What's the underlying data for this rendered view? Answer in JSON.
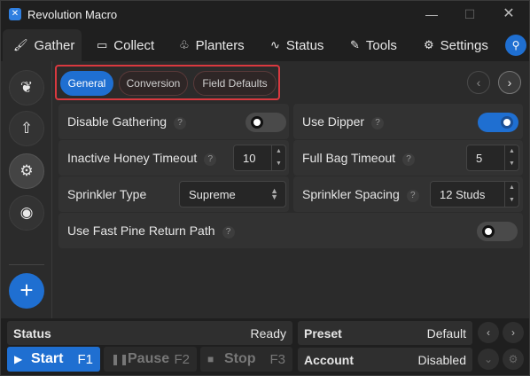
{
  "window": {
    "title": "Revolution Macro",
    "app_icon": "macro-app-icon",
    "controls": {
      "minimize": "—",
      "maximize": "☐",
      "close": "✕"
    }
  },
  "main_tabs": [
    {
      "label": "Gather",
      "icon": "brush-icon",
      "glyph": "🖌"
    },
    {
      "label": "Collect",
      "icon": "box-icon",
      "glyph": "▭"
    },
    {
      "label": "Planters",
      "icon": "sprout-icon",
      "glyph": "♧"
    },
    {
      "label": "Status",
      "icon": "pulse-icon",
      "glyph": "∿"
    },
    {
      "label": "Tools",
      "icon": "wrench-icon",
      "glyph": "✎"
    },
    {
      "label": "Settings",
      "icon": "gear-icon",
      "glyph": "⚙"
    }
  ],
  "search_icon": "⚲",
  "sidebar": {
    "buttons": [
      {
        "icon": "leaf-icon",
        "glyph": "❦"
      },
      {
        "icon": "arrow-up-icon",
        "glyph": "⇧"
      },
      {
        "icon": "gear-icon",
        "glyph": "⚙"
      },
      {
        "icon": "eye-scan-icon",
        "glyph": "◉"
      }
    ],
    "add_glyph": "+"
  },
  "subtabs": [
    "General",
    "Conversion",
    "Field Defaults"
  ],
  "nav": {
    "prev": "‹",
    "next": "›"
  },
  "settings": {
    "disable_gathering": {
      "label": "Disable Gathering",
      "value": false
    },
    "use_dipper": {
      "label": "Use Dipper",
      "value": true
    },
    "inactive_honey_timeout": {
      "label": "Inactive Honey Timeout",
      "value": "10"
    },
    "full_bag_timeout": {
      "label": "Full Bag Timeout",
      "value": "5"
    },
    "sprinkler_type": {
      "label": "Sprinkler Type",
      "value": "Supreme"
    },
    "sprinkler_spacing": {
      "label": "Sprinkler Spacing",
      "value": "12 Studs"
    },
    "use_fast_pine_return_path": {
      "label": "Use Fast Pine Return Path",
      "value": false
    }
  },
  "help_glyph": "?",
  "bottom": {
    "status_label": "Status",
    "status_value": "Ready",
    "preset_label": "Preset",
    "preset_value": "Default",
    "account_label": "Account",
    "account_value": "Disabled",
    "start": {
      "label": "Start",
      "key": "F1",
      "glyph": "▶"
    },
    "pause": {
      "label": "Pause",
      "key": "F2",
      "glyph": "❚❚"
    },
    "stop": {
      "label": "Stop",
      "key": "F3",
      "glyph": "■"
    }
  },
  "colors": {
    "accent": "#1f6fd1",
    "highlight_border": "#d9393f",
    "background": "#1f1f1f",
    "panel": "#2b2b2b"
  }
}
